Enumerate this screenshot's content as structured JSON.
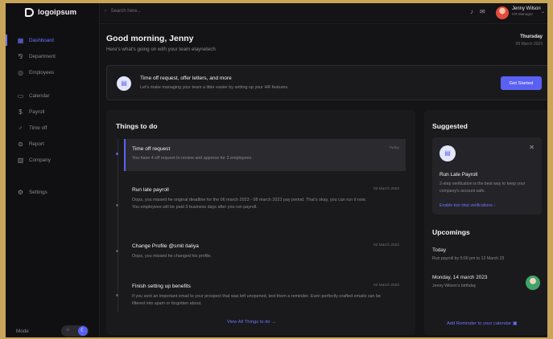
{
  "brand": {
    "name": "logoipsum"
  },
  "sidebar": {
    "items": [
      {
        "label": "Dashboard",
        "icon": "grid-icon",
        "glyph": "▦",
        "active": true
      },
      {
        "label": "Department",
        "icon": "department-icon",
        "glyph": "⅋",
        "active": false
      },
      {
        "label": "Employees",
        "icon": "employees-icon",
        "glyph": "◎",
        "active": false
      },
      {
        "label": "Calendar",
        "icon": "calendar-icon",
        "glyph": "▭",
        "active": false
      },
      {
        "label": "Payroll",
        "icon": "payroll-icon",
        "glyph": "$",
        "active": false
      },
      {
        "label": "Time off",
        "icon": "time-off-icon",
        "glyph": "♂",
        "active": false
      },
      {
        "label": "Report",
        "icon": "report-icon",
        "glyph": "⊜",
        "active": false
      },
      {
        "label": "Company",
        "icon": "company-icon",
        "glyph": "▥",
        "active": false
      },
      {
        "label": "Settings",
        "icon": "settings-icon",
        "glyph": "⚙",
        "active": false
      }
    ],
    "mode_label": "Mode"
  },
  "topbar": {
    "search_placeholder": "Search here...",
    "user_name": "Jenny Wilson",
    "user_role": "HR Manager"
  },
  "greeting": {
    "title": "Good morning, Jenny",
    "subtitle": "Here's what's going on with your team elaynetech",
    "day": "Thursday",
    "date": "09 March 2023"
  },
  "banner": {
    "title": "Time off request, offer letters, and more",
    "subtitle": "Let's make managing your team a litter easier by setting up your HR features.",
    "button": "Get Started"
  },
  "todo": {
    "title": "Things to do",
    "tasks": [
      {
        "name": "Time off request",
        "date": "Today",
        "desc": "You have 4 off request to review and approve for 3 employees."
      },
      {
        "name": "Run late payroll",
        "date": "06 March 2023",
        "desc": "Oops, you missed he original deadline for the 06 march 2023 - 08 march 2023 pay period. That's okay, you can run it now. You employees will be paid 3 business days after you run payroll."
      },
      {
        "name": "Change Profile @smit italiya",
        "date": "02 March 2023",
        "desc": "Oops, you missed he changed his profile."
      },
      {
        "name": "Finish setting up benefits",
        "date": "02 March 2023",
        "desc": "If you sent an important email to your prospect that was left unopened, text them a reminder. Even perfectly-crafted emails can be filtered into spam or forgotten about."
      }
    ],
    "view_all": "View All Things to do"
  },
  "suggested": {
    "title": "Suggested",
    "card_title": "Run Late Payroll",
    "card_desc": "2-step verification is the best way to keep your company's account safe.",
    "card_link": "Enable two step verifications"
  },
  "upcomings": {
    "title": "Upcomings",
    "items": [
      {
        "heading": "Today",
        "sub": "Run payroll by 5:00 pm to 12 March 23"
      },
      {
        "heading": "Monday, 14 march 2023",
        "sub": "Jenny Wilson's birthday"
      }
    ],
    "reminder": "Add Reminder to your calendar"
  }
}
